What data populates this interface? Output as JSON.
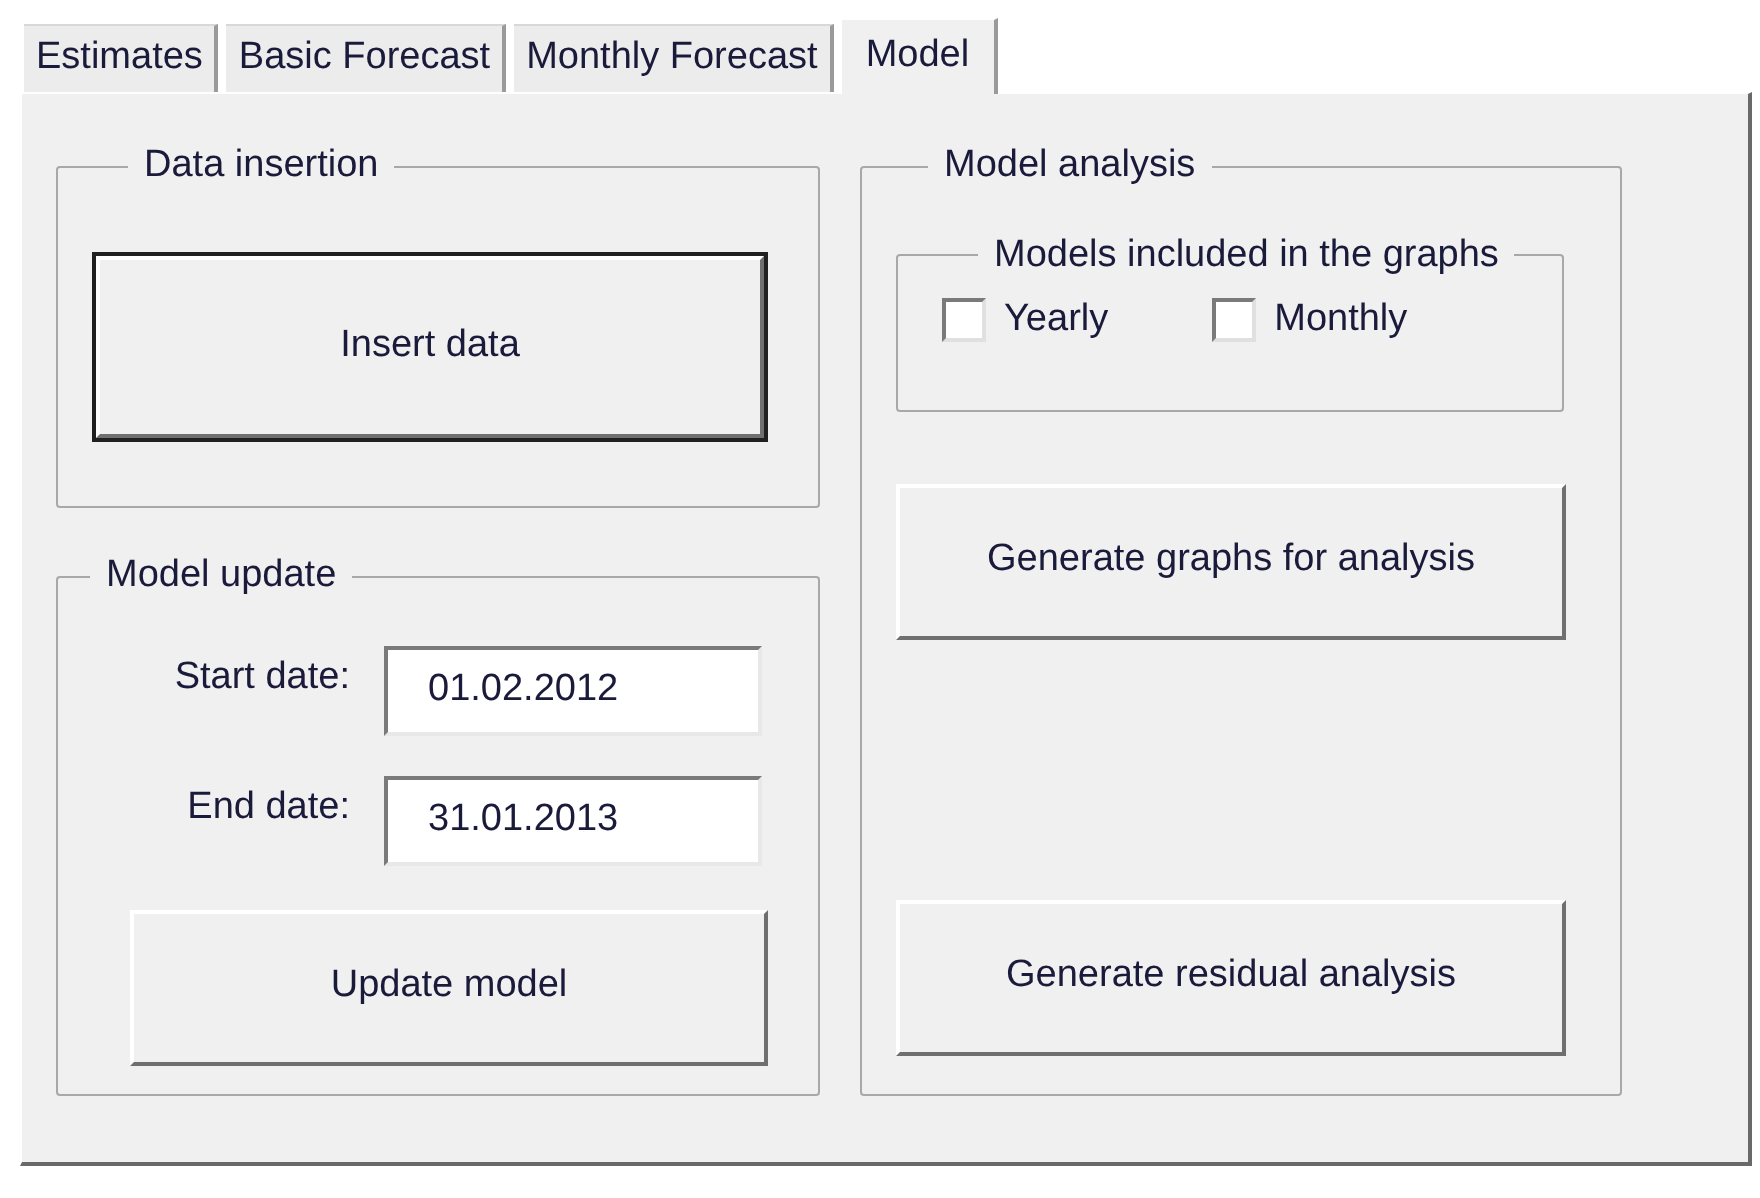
{
  "tabs": [
    {
      "label": "Estimates",
      "selected": false
    },
    {
      "label": "Basic Forecast",
      "selected": false
    },
    {
      "label": "Monthly Forecast",
      "selected": false
    },
    {
      "label": "Model",
      "selected": true
    }
  ],
  "data_insertion": {
    "title": "Data insertion",
    "button": {
      "label": "Insert data",
      "default": true
    }
  },
  "model_update": {
    "title": "Model update",
    "fields": [
      {
        "label": "Start date:",
        "value": "01.02.2012"
      },
      {
        "label": "End date:",
        "value": "31.01.2013"
      }
    ],
    "button": {
      "label": "Update model"
    }
  },
  "model_analysis": {
    "title": "Model analysis",
    "models_group": {
      "title": "Models included in the graphs",
      "checkboxes": [
        {
          "label": "Yearly",
          "checked": false
        },
        {
          "label": "Monthly",
          "checked": false
        }
      ]
    },
    "buttons": [
      {
        "label": "Generate graphs for analysis"
      },
      {
        "label": "Generate residual analysis"
      }
    ]
  }
}
